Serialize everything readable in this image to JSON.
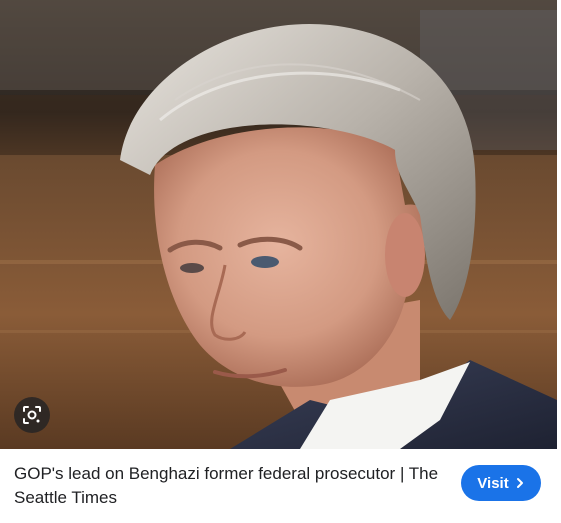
{
  "result": {
    "title": "GOP's lead on Benghazi former federal prosecutor | The Seattle Times",
    "visit_label": "Visit",
    "visit_icon": "chevron-right-icon",
    "lens_icon": "visual-search-icon",
    "photo_subject": "portrait-photo"
  },
  "colors": {
    "accent": "#1a73e8",
    "text": "#202124"
  }
}
